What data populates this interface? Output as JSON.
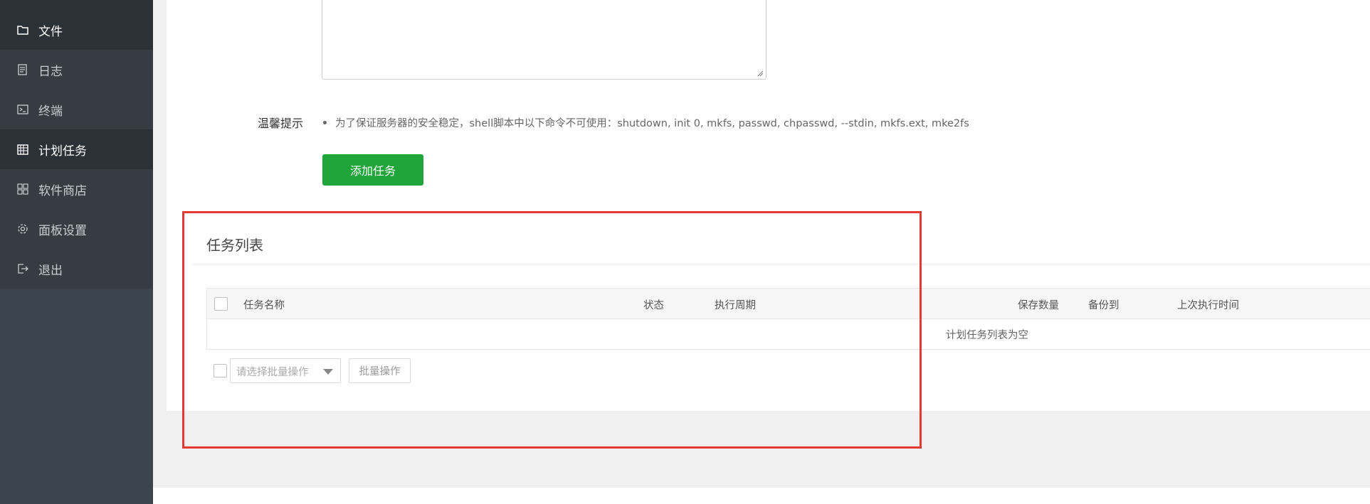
{
  "sidebar": {
    "items": [
      {
        "label": "文件",
        "icon": "folder-icon"
      },
      {
        "label": "日志",
        "icon": "log-icon"
      },
      {
        "label": "终端",
        "icon": "terminal-icon"
      },
      {
        "label": "计划任务",
        "icon": "calendar-icon"
      },
      {
        "label": "软件商店",
        "icon": "grid-icon"
      },
      {
        "label": "面板设置",
        "icon": "gear-icon"
      },
      {
        "label": "退出",
        "icon": "logout-icon"
      }
    ],
    "active_index": 3
  },
  "form": {
    "tip_label": "温馨提示",
    "tip_text": "为了保证服务器的安全稳定，shell脚本中以下命令不可使用：shutdown, init 0, mkfs, passwd, chpasswd, --stdin, mkfs.ext, mke2fs",
    "add_button": "添加任务"
  },
  "task_list": {
    "title": "任务列表",
    "columns": [
      "任务名称",
      "状态",
      "执行周期",
      "保存数量",
      "备份到",
      "上次执行时间"
    ],
    "empty_text": "计划任务列表为空",
    "batch_placeholder": "请选择批量操作",
    "batch_button": "批量操作"
  },
  "colors": {
    "sidebar_bg": "#3c444d",
    "sidebar_active": "#2c3138",
    "accent_green": "#20a53a",
    "highlight_red": "#e53935"
  }
}
